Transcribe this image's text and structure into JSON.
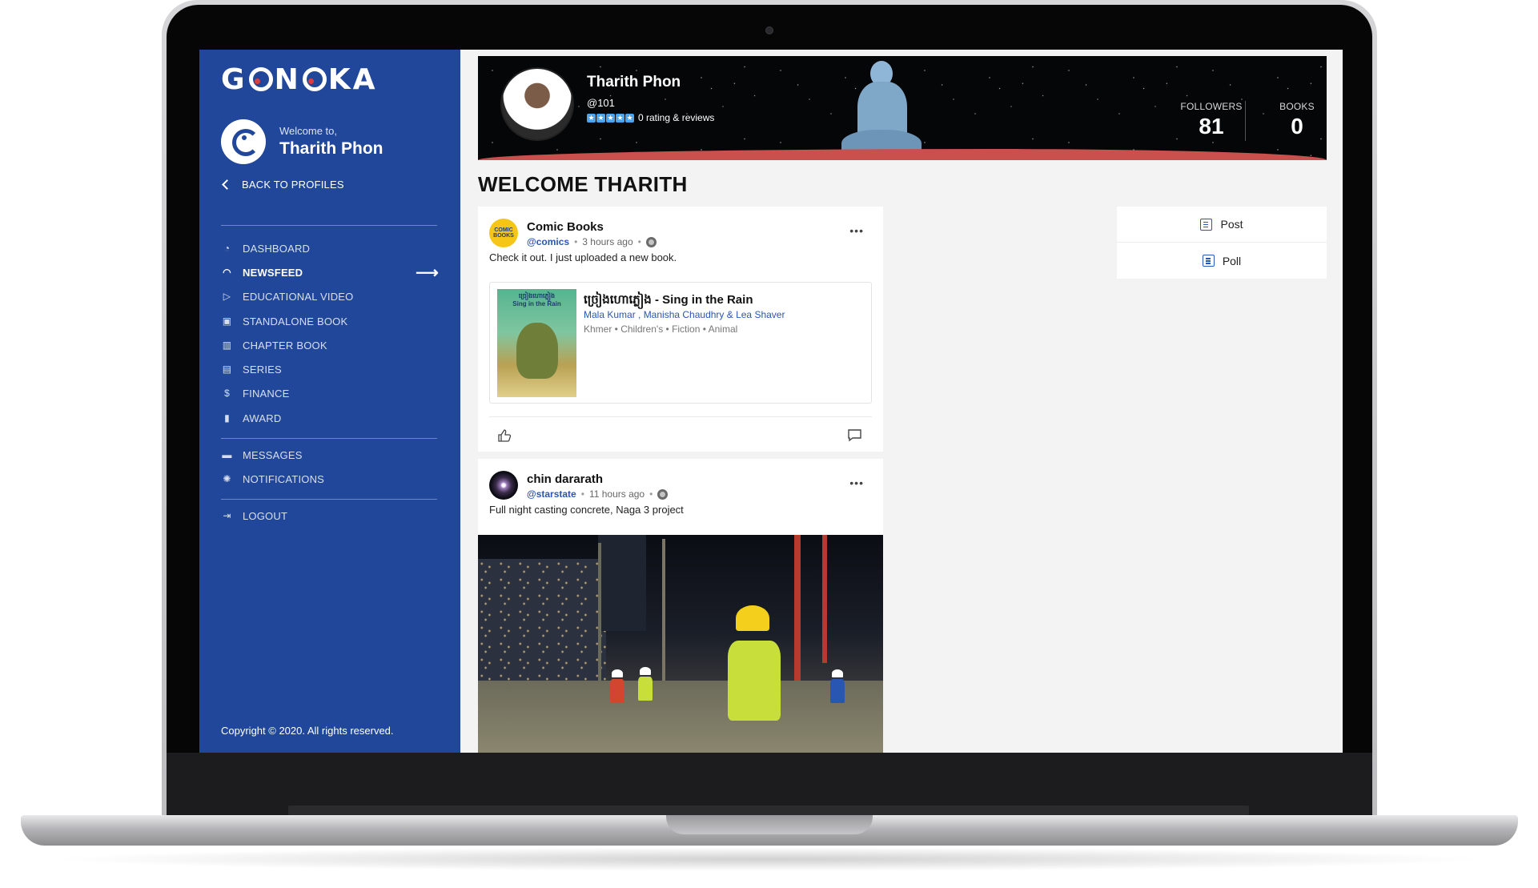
{
  "brand": {
    "name": "GONOKA"
  },
  "sidebar": {
    "welcome_small": "Welcome to,",
    "welcome_name": "Tharith Phon",
    "back_label": "BACK TO PROFILES",
    "items": [
      {
        "label": "DASHBOARD",
        "icon": "dashboard-icon"
      },
      {
        "label": "NEWSFEED",
        "icon": "rss-icon",
        "active": true
      },
      {
        "label": "EDUCATIONAL VIDEO",
        "icon": "play-icon"
      },
      {
        "label": "STANDALONE BOOK",
        "icon": "book-icon"
      },
      {
        "label": "CHAPTER BOOK",
        "icon": "library-icon"
      },
      {
        "label": "SERIES",
        "icon": "stack-icon"
      },
      {
        "label": "FINANCE",
        "icon": "dollar-icon"
      },
      {
        "label": "AWARD",
        "icon": "clipboard-icon"
      }
    ],
    "secondary": [
      {
        "label": "MESSAGES",
        "icon": "chat-icon"
      },
      {
        "label": "NOTIFICATIONS",
        "icon": "bell-icon"
      }
    ],
    "logout_label": "LOGOUT",
    "copyright": "Copyright © 2020. All rights reserved."
  },
  "profile": {
    "name": "Tharith Phon",
    "handle": "@101",
    "rating_text": "0 rating & reviews",
    "followers_label": "FOLLOWERS",
    "followers": "81",
    "books_label": "BOOKS",
    "books": "0"
  },
  "page_title": "WELCOME THARITH",
  "posts": [
    {
      "author": "Comic Books",
      "handle": "@comics",
      "time": "3 hours ago",
      "text": "Check it out. I just uploaded a new book.",
      "book": {
        "title": "ច្រៀងហោភ្លៀង - Sing in the Rain",
        "cover_title": "ច្រៀងហោភ្លៀង\nSing in the Rain",
        "authors": "Mala Kumar , Manisha Chaudhry & Lea Shaver",
        "tags": "Khmer • Children's • Fiction • Animal"
      }
    },
    {
      "author": "chin dararath",
      "handle": "@starstate",
      "time": "11 hours ago",
      "text": "Full night casting concrete, Naga 3 project"
    }
  ],
  "actions": [
    {
      "label": "Post",
      "icon": "edit-icon"
    },
    {
      "label": "Poll",
      "icon": "poll-icon"
    }
  ],
  "colors": {
    "sidebar": "#21479a",
    "link": "#2a56b3",
    "accent_star": "#4aa4ee"
  }
}
